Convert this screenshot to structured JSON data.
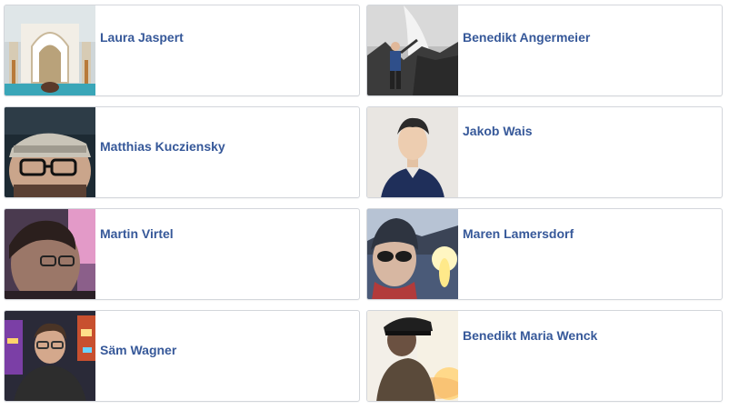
{
  "friends": [
    {
      "name": "Laura Jaspert",
      "photo_icon": "profile-photo-laura"
    },
    {
      "name": "Benedikt Angermeier",
      "photo_icon": "profile-photo-benedikt-a"
    },
    {
      "name": "Matthias Kucziensky",
      "photo_icon": "profile-photo-matthias"
    },
    {
      "name": "Jakob Wais",
      "photo_icon": "profile-photo-jakob"
    },
    {
      "name": "Martin Virtel",
      "photo_icon": "profile-photo-martin"
    },
    {
      "name": "Maren Lamersdorf",
      "photo_icon": "profile-photo-maren"
    },
    {
      "name": "Säm Wagner",
      "photo_icon": "profile-photo-saem"
    },
    {
      "name": "Benedikt Maria Wenck",
      "photo_icon": "profile-photo-benedikt-mw"
    }
  ],
  "colors": {
    "name_link": "#365899",
    "card_border": "#d3d6db",
    "background": "#ffffff"
  }
}
